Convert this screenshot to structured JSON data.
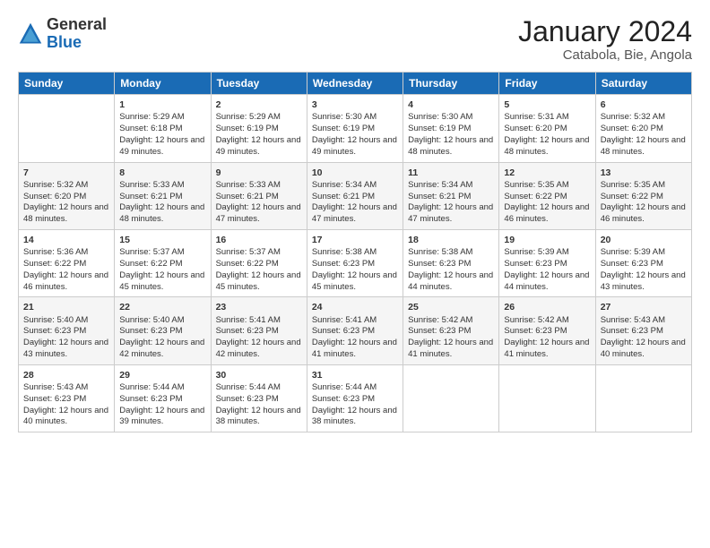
{
  "logo": {
    "general": "General",
    "blue": "Blue"
  },
  "title": "January 2024",
  "subtitle": "Catabola, Bie, Angola",
  "days_of_week": [
    "Sunday",
    "Monday",
    "Tuesday",
    "Wednesday",
    "Thursday",
    "Friday",
    "Saturday"
  ],
  "weeks": [
    [
      {
        "day": "",
        "sunrise": "",
        "sunset": "",
        "daylight": ""
      },
      {
        "day": "1",
        "sunrise": "Sunrise: 5:29 AM",
        "sunset": "Sunset: 6:18 PM",
        "daylight": "Daylight: 12 hours and 49 minutes."
      },
      {
        "day": "2",
        "sunrise": "Sunrise: 5:29 AM",
        "sunset": "Sunset: 6:19 PM",
        "daylight": "Daylight: 12 hours and 49 minutes."
      },
      {
        "day": "3",
        "sunrise": "Sunrise: 5:30 AM",
        "sunset": "Sunset: 6:19 PM",
        "daylight": "Daylight: 12 hours and 49 minutes."
      },
      {
        "day": "4",
        "sunrise": "Sunrise: 5:30 AM",
        "sunset": "Sunset: 6:19 PM",
        "daylight": "Daylight: 12 hours and 48 minutes."
      },
      {
        "day": "5",
        "sunrise": "Sunrise: 5:31 AM",
        "sunset": "Sunset: 6:20 PM",
        "daylight": "Daylight: 12 hours and 48 minutes."
      },
      {
        "day": "6",
        "sunrise": "Sunrise: 5:32 AM",
        "sunset": "Sunset: 6:20 PM",
        "daylight": "Daylight: 12 hours and 48 minutes."
      }
    ],
    [
      {
        "day": "7",
        "sunrise": "Sunrise: 5:32 AM",
        "sunset": "Sunset: 6:20 PM",
        "daylight": "Daylight: 12 hours and 48 minutes."
      },
      {
        "day": "8",
        "sunrise": "Sunrise: 5:33 AM",
        "sunset": "Sunset: 6:21 PM",
        "daylight": "Daylight: 12 hours and 48 minutes."
      },
      {
        "day": "9",
        "sunrise": "Sunrise: 5:33 AM",
        "sunset": "Sunset: 6:21 PM",
        "daylight": "Daylight: 12 hours and 47 minutes."
      },
      {
        "day": "10",
        "sunrise": "Sunrise: 5:34 AM",
        "sunset": "Sunset: 6:21 PM",
        "daylight": "Daylight: 12 hours and 47 minutes."
      },
      {
        "day": "11",
        "sunrise": "Sunrise: 5:34 AM",
        "sunset": "Sunset: 6:21 PM",
        "daylight": "Daylight: 12 hours and 47 minutes."
      },
      {
        "day": "12",
        "sunrise": "Sunrise: 5:35 AM",
        "sunset": "Sunset: 6:22 PM",
        "daylight": "Daylight: 12 hours and 46 minutes."
      },
      {
        "day": "13",
        "sunrise": "Sunrise: 5:35 AM",
        "sunset": "Sunset: 6:22 PM",
        "daylight": "Daylight: 12 hours and 46 minutes."
      }
    ],
    [
      {
        "day": "14",
        "sunrise": "Sunrise: 5:36 AM",
        "sunset": "Sunset: 6:22 PM",
        "daylight": "Daylight: 12 hours and 46 minutes."
      },
      {
        "day": "15",
        "sunrise": "Sunrise: 5:37 AM",
        "sunset": "Sunset: 6:22 PM",
        "daylight": "Daylight: 12 hours and 45 minutes."
      },
      {
        "day": "16",
        "sunrise": "Sunrise: 5:37 AM",
        "sunset": "Sunset: 6:22 PM",
        "daylight": "Daylight: 12 hours and 45 minutes."
      },
      {
        "day": "17",
        "sunrise": "Sunrise: 5:38 AM",
        "sunset": "Sunset: 6:23 PM",
        "daylight": "Daylight: 12 hours and 45 minutes."
      },
      {
        "day": "18",
        "sunrise": "Sunrise: 5:38 AM",
        "sunset": "Sunset: 6:23 PM",
        "daylight": "Daylight: 12 hours and 44 minutes."
      },
      {
        "day": "19",
        "sunrise": "Sunrise: 5:39 AM",
        "sunset": "Sunset: 6:23 PM",
        "daylight": "Daylight: 12 hours and 44 minutes."
      },
      {
        "day": "20",
        "sunrise": "Sunrise: 5:39 AM",
        "sunset": "Sunset: 6:23 PM",
        "daylight": "Daylight: 12 hours and 43 minutes."
      }
    ],
    [
      {
        "day": "21",
        "sunrise": "Sunrise: 5:40 AM",
        "sunset": "Sunset: 6:23 PM",
        "daylight": "Daylight: 12 hours and 43 minutes."
      },
      {
        "day": "22",
        "sunrise": "Sunrise: 5:40 AM",
        "sunset": "Sunset: 6:23 PM",
        "daylight": "Daylight: 12 hours and 42 minutes."
      },
      {
        "day": "23",
        "sunrise": "Sunrise: 5:41 AM",
        "sunset": "Sunset: 6:23 PM",
        "daylight": "Daylight: 12 hours and 42 minutes."
      },
      {
        "day": "24",
        "sunrise": "Sunrise: 5:41 AM",
        "sunset": "Sunset: 6:23 PM",
        "daylight": "Daylight: 12 hours and 41 minutes."
      },
      {
        "day": "25",
        "sunrise": "Sunrise: 5:42 AM",
        "sunset": "Sunset: 6:23 PM",
        "daylight": "Daylight: 12 hours and 41 minutes."
      },
      {
        "day": "26",
        "sunrise": "Sunrise: 5:42 AM",
        "sunset": "Sunset: 6:23 PM",
        "daylight": "Daylight: 12 hours and 41 minutes."
      },
      {
        "day": "27",
        "sunrise": "Sunrise: 5:43 AM",
        "sunset": "Sunset: 6:23 PM",
        "daylight": "Daylight: 12 hours and 40 minutes."
      }
    ],
    [
      {
        "day": "28",
        "sunrise": "Sunrise: 5:43 AM",
        "sunset": "Sunset: 6:23 PM",
        "daylight": "Daylight: 12 hours and 40 minutes."
      },
      {
        "day": "29",
        "sunrise": "Sunrise: 5:44 AM",
        "sunset": "Sunset: 6:23 PM",
        "daylight": "Daylight: 12 hours and 39 minutes."
      },
      {
        "day": "30",
        "sunrise": "Sunrise: 5:44 AM",
        "sunset": "Sunset: 6:23 PM",
        "daylight": "Daylight: 12 hours and 38 minutes."
      },
      {
        "day": "31",
        "sunrise": "Sunrise: 5:44 AM",
        "sunset": "Sunset: 6:23 PM",
        "daylight": "Daylight: 12 hours and 38 minutes."
      },
      {
        "day": "",
        "sunrise": "",
        "sunset": "",
        "daylight": ""
      },
      {
        "day": "",
        "sunrise": "",
        "sunset": "",
        "daylight": ""
      },
      {
        "day": "",
        "sunrise": "",
        "sunset": "",
        "daylight": ""
      }
    ]
  ]
}
